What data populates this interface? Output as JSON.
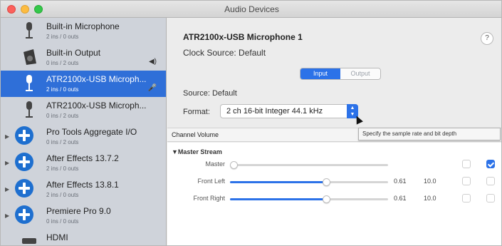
{
  "window": {
    "title": "Audio Devices"
  },
  "sidebar": {
    "devices": [
      {
        "name": "Built-in Microphone",
        "io": "2 ins / 0 outs",
        "icon": "microphone-icon",
        "selected": false,
        "badge": ""
      },
      {
        "name": "Built-in Output",
        "io": "0 ins / 2 outs",
        "icon": "speaker-icon",
        "selected": false,
        "badge": "◀)"
      },
      {
        "name": "ATR2100x-USB Microph...",
        "io": "2 ins / 0 outs",
        "icon": "usb-microphone-icon",
        "selected": true,
        "badge": "🎤"
      },
      {
        "name": "ATR2100x-USB Microph...",
        "io": "0 ins / 2 outs",
        "icon": "usb-microphone-icon",
        "selected": false,
        "badge": ""
      },
      {
        "name": "Pro Tools Aggregate I/O",
        "io": "0 ins / 2 outs",
        "icon": "aggregate-device-icon",
        "selected": false,
        "badge": ""
      },
      {
        "name": "After Effects 13.7.2",
        "io": "2 ins / 0 outs",
        "icon": "aggregate-device-icon",
        "selected": false,
        "badge": ""
      },
      {
        "name": "After Effects 13.8.1",
        "io": "2 ins / 0 outs",
        "icon": "aggregate-device-icon",
        "selected": false,
        "badge": ""
      },
      {
        "name": "Premiere Pro 9.0",
        "io": "0 ins / 0 outs",
        "icon": "aggregate-device-icon",
        "selected": false,
        "badge": ""
      },
      {
        "name": "HDMI",
        "io": "",
        "icon": "hdmi-icon",
        "selected": false,
        "badge": ""
      }
    ]
  },
  "main": {
    "device_title": "ATR2100x-USB Microphone 1",
    "clock_source": "Clock Source:  Default",
    "help": "?",
    "tabs": [
      {
        "label": "Input",
        "active": true
      },
      {
        "label": "Output",
        "active": false
      }
    ],
    "source": "Source:  Default",
    "format_label": "Format:",
    "format_value": "2 ch 16-bit Integer 44.1 kHz",
    "tooltip": "Specify the sample rate and bit depth",
    "channel_volume_header": "Channel Volume",
    "stream_label": "▼Master Stream",
    "rows": [
      {
        "label": "Master",
        "level": 0.0,
        "value": "",
        "db": "",
        "mute": false,
        "thru": true
      },
      {
        "label": "Front Left",
        "level": 0.61,
        "value": "0.61",
        "db": "10.0",
        "mute": false,
        "thru": false
      },
      {
        "label": "Front Right",
        "level": 0.61,
        "value": "0.61",
        "db": "10.0",
        "mute": false,
        "thru": false
      }
    ]
  },
  "colors": {
    "accent": "#2c72e8",
    "selection": "#2f6fd8",
    "sidebar": "#cfd3da"
  }
}
